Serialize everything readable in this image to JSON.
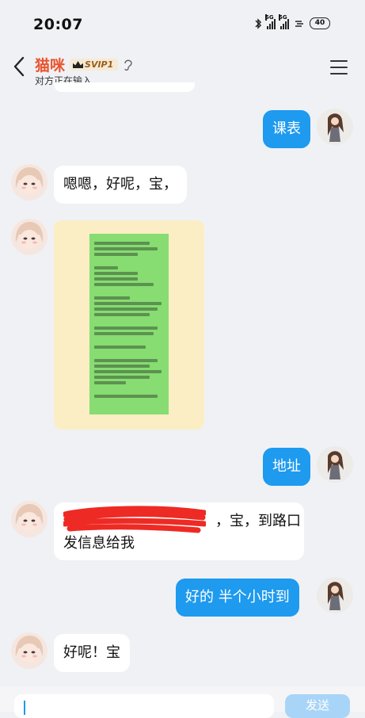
{
  "status_bar": {
    "time": "20:07",
    "network_label": "5G",
    "battery": "40",
    "icons": [
      "bluetooth-icon",
      "signal-5g-icon",
      "signal-5g-icon",
      "data-sync-icon",
      "battery-icon"
    ]
  },
  "header": {
    "title": "猫咪",
    "vip_badge": "SVIP1",
    "subtitle": "对方正在输入...",
    "icons": [
      "back-arrow-icon",
      "crown-icon",
      "ear-icon",
      "menu-icon"
    ]
  },
  "messages": [
    {
      "from": "me",
      "text": "课表"
    },
    {
      "from": "them",
      "text": "嗯嗯，好呢，宝，"
    },
    {
      "from": "them",
      "type": "image",
      "description_icon": "image-thumbnail"
    },
    {
      "from": "me",
      "text": "地址"
    },
    {
      "from": "them",
      "text_line1": "准备出发了到路口了，宝，到路口",
      "text_line2": "发信息给我",
      "visible_line1": "，宝，到路口",
      "visible_prefix": "准"
    },
    {
      "from": "me",
      "text": "好的  半个小时到"
    },
    {
      "from": "them",
      "text": "好呢！宝"
    }
  ],
  "input": {
    "placeholder": "",
    "send_label": "发送"
  },
  "colors": {
    "background": "#f0f1f5",
    "outgoing_bubble": "#1e9aef",
    "incoming_bubble": "#ffffff",
    "title": "#e8552e",
    "send_disabled": "#a8d5f7"
  }
}
